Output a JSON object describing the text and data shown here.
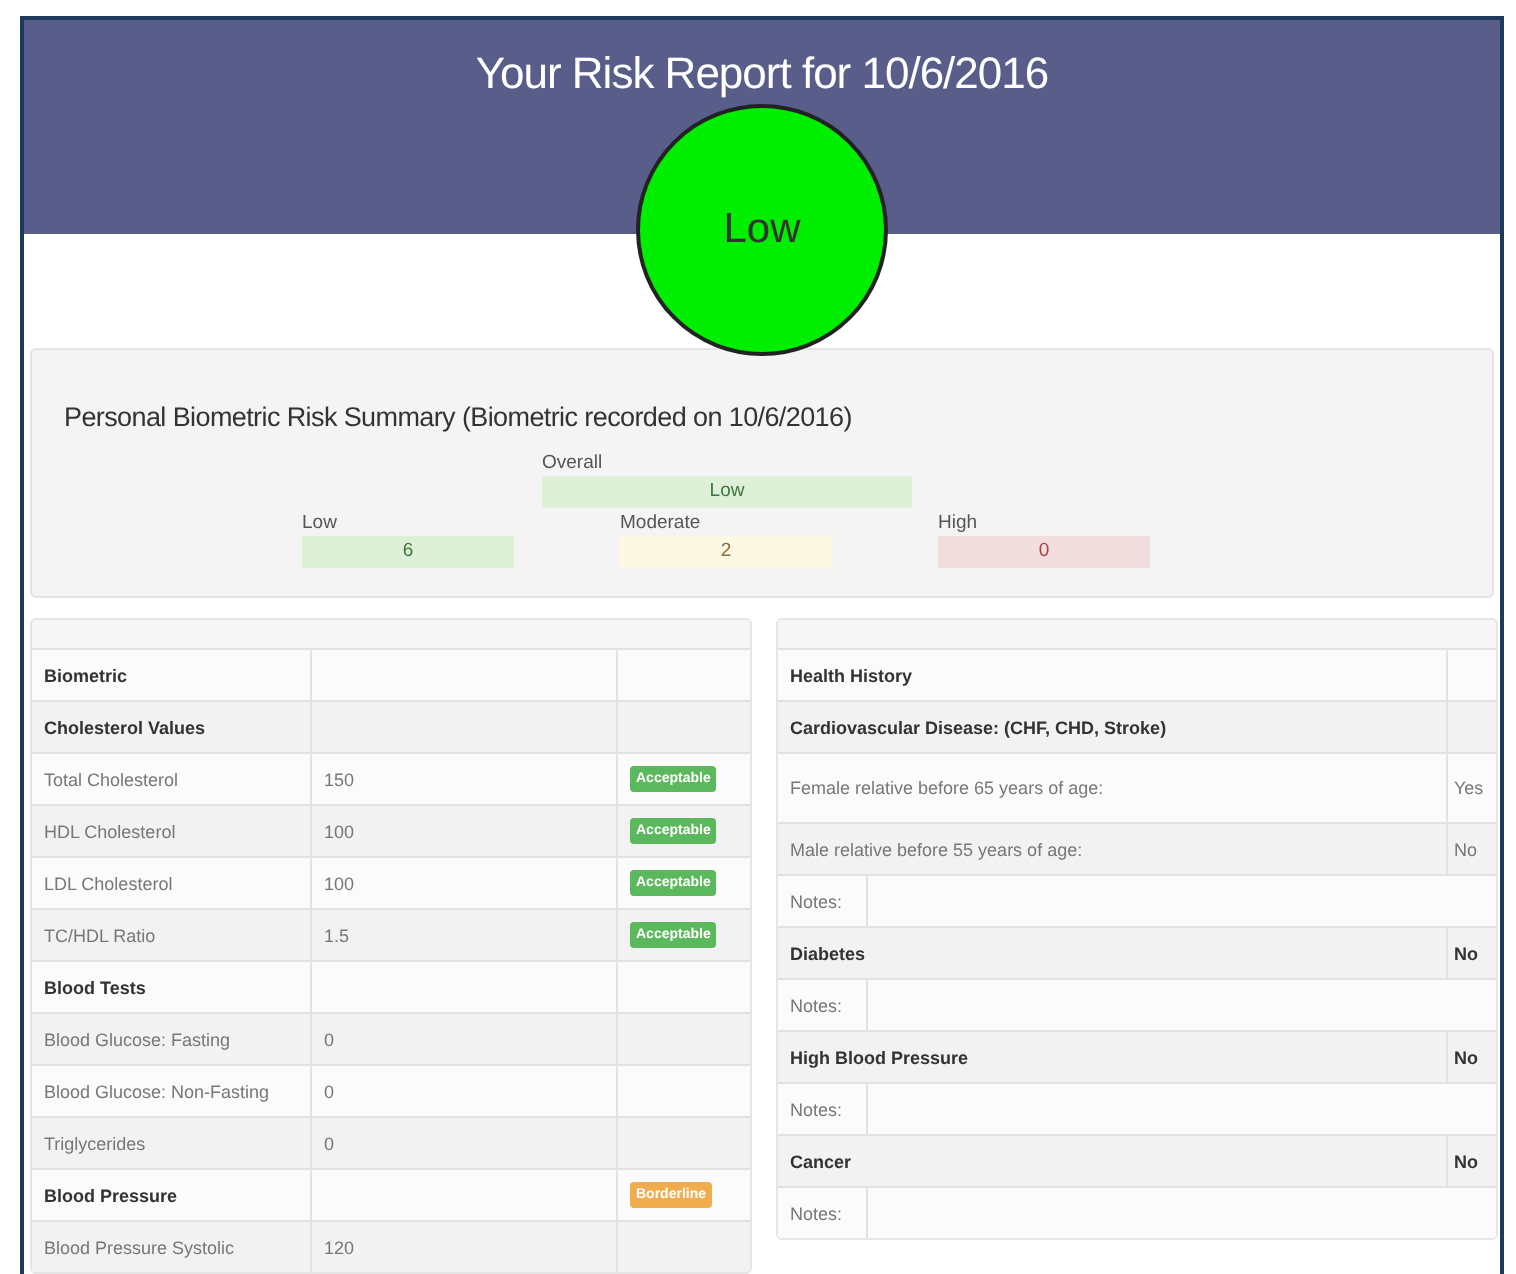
{
  "header": {
    "title": "Your Risk Report for 10/6/2016",
    "risk": {
      "label": "Low",
      "color": "#00ee00"
    }
  },
  "summary": {
    "title": "Personal Biometric Risk Summary (Biometric recorded on 10/6/2016)",
    "overall": {
      "label": "Overall",
      "value": "Low",
      "color": "#dff0d8"
    },
    "levels": [
      {
        "label": "Low",
        "value": "6",
        "color": "#dff0d8"
      },
      {
        "label": "Moderate",
        "value": "2",
        "color": "#fcf8e3"
      },
      {
        "label": "High",
        "value": "0",
        "color": "#f2dede"
      }
    ]
  },
  "biometric": {
    "rows": [
      {
        "kind": "section",
        "label": "Biometric"
      },
      {
        "kind": "section",
        "label": "Cholesterol Values"
      },
      {
        "kind": "item",
        "label": "Total Cholesterol",
        "value": "150",
        "badge": {
          "label": "Acceptable",
          "color": "#5cb85c"
        }
      },
      {
        "kind": "item",
        "label": "HDL Cholesterol",
        "value": "100",
        "badge": {
          "label": "Acceptable",
          "color": "#5cb85c"
        }
      },
      {
        "kind": "item",
        "label": "LDL Cholesterol",
        "value": "100",
        "badge": {
          "label": "Acceptable",
          "color": "#5cb85c"
        }
      },
      {
        "kind": "item",
        "label": "TC/HDL Ratio",
        "value": "1.5",
        "badge": {
          "label": "Acceptable",
          "color": "#5cb85c"
        }
      },
      {
        "kind": "section",
        "label": "Blood Tests"
      },
      {
        "kind": "item",
        "label": "Blood Glucose: Fasting",
        "value": "0"
      },
      {
        "kind": "item",
        "label": "Blood Glucose: Non-Fasting",
        "value": "0"
      },
      {
        "kind": "item",
        "label": "Triglycerides",
        "value": "0"
      },
      {
        "kind": "section",
        "label": "Blood Pressure",
        "badge": {
          "label": "Borderline",
          "color": "#f0ad4e"
        }
      },
      {
        "kind": "item",
        "label": "Blood Pressure Systolic",
        "value": "120"
      }
    ]
  },
  "health_history": {
    "rows": [
      {
        "kind": "section",
        "label": "Health History"
      },
      {
        "kind": "section",
        "label": "Cardiovascular Disease: (CHF, CHD, Stroke)"
      },
      {
        "kind": "item",
        "label": "Female relative before 65 years of age:",
        "value": "Yes"
      },
      {
        "kind": "item",
        "label": "Male relative before 55 years of age:",
        "value": "No"
      },
      {
        "kind": "notes",
        "label": "Notes:"
      },
      {
        "kind": "section",
        "label": "Diabetes",
        "value": "No"
      },
      {
        "kind": "notes",
        "label": "Notes:"
      },
      {
        "kind": "section",
        "label": "High Blood Pressure",
        "value": "No"
      },
      {
        "kind": "notes",
        "label": "Notes:"
      },
      {
        "kind": "section",
        "label": "Cancer",
        "value": "No"
      },
      {
        "kind": "notes",
        "label": "Notes:"
      }
    ]
  }
}
